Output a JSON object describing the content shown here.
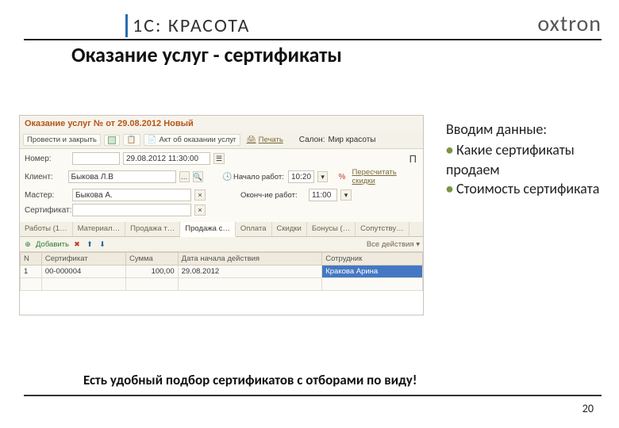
{
  "header": {
    "product": "1С: КРАСОТА",
    "brand": "oxtron"
  },
  "subtitle": "Оказание услуг - сертификаты",
  "app": {
    "title": "Оказание услуг № от 29.08.2012 Новый",
    "toolbar": {
      "save_close": "Провести и закрыть",
      "post_icon": "▦",
      "act": "Акт об оказании услуг",
      "print": "Печать",
      "salon_lbl": "Салон:",
      "salon_val": "Мир красоты"
    },
    "fields": {
      "number_lbl": "Номер:",
      "date_val": "29.08.2012 11:30:00",
      "client_lbl": "Клиент:",
      "client_val": "Быкова Л.В",
      "master_lbl": "Мастер:",
      "master_val": "Быкова А.",
      "cert_lbl": "Сертификат:",
      "start_lbl": "Начало работ:",
      "start_val": "10:20",
      "end_lbl": "Оконч-ие работ:",
      "end_val": "11:00",
      "recalc": "Пересчитать скидки"
    },
    "tabs": [
      "Работы (1…",
      "Материал…",
      "Продажа т…",
      "Продажа с…",
      "Оплата",
      "Скидки",
      "Бонусы (…",
      "Сопутству…"
    ],
    "active_tab": 3,
    "subtoolbar": {
      "add": "Добавить",
      "all": "Все действия"
    },
    "grid": {
      "headers": [
        "N",
        "Сертификат",
        "Сумма",
        "Дата начала действия",
        "Сотрудник"
      ],
      "row": {
        "n": "1",
        "cert": "00-000004",
        "sum": "100,00",
        "date": "29.08.2012",
        "emp": "Кракова Арина"
      }
    }
  },
  "side": {
    "heading": "Вводим данные:",
    "b1": "Какие сертификаты продаем",
    "b2": "Стоимость сертификата"
  },
  "footnote": "Есть удобный подбор сертификатов с отборами по виду!",
  "page": "20"
}
